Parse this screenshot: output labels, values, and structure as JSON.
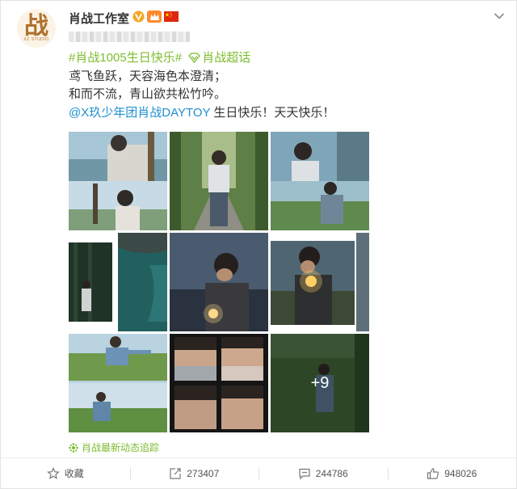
{
  "post": {
    "author_name": "肖战工作室",
    "avatar_glyph": "战",
    "avatar_subtext": "XZ STUDIO",
    "hashtag": "#肖战1005生日快乐#",
    "super_topic": "肖战超话",
    "lines": [
      "鸢飞鱼跃，天容海色本澄清；",
      "和而不流，青山欲共松竹吟。"
    ],
    "mention": "@X玖少年团肖战DAYTOY",
    "mention_suffix": " 生日快乐！天天快乐！",
    "more_images": "+9",
    "track_label": "肖战最新动态追踪"
  },
  "footer": {
    "favorite_label": "收藏",
    "repost_count": "273407",
    "comment_count": "244786",
    "like_count": "948026"
  },
  "colors": {
    "accent_green": "#7dbc2f",
    "mention_blue": "#1d8fd0",
    "vip_orange": "#ff8a2d",
    "verified_orange": "#f5a623"
  },
  "icons": [
    "verified-icon",
    "vip-icon",
    "china-flag-icon",
    "chevron-down-icon",
    "super-topic-icon",
    "track-icon",
    "star-icon",
    "repost-icon",
    "comment-icon",
    "like-icon"
  ]
}
